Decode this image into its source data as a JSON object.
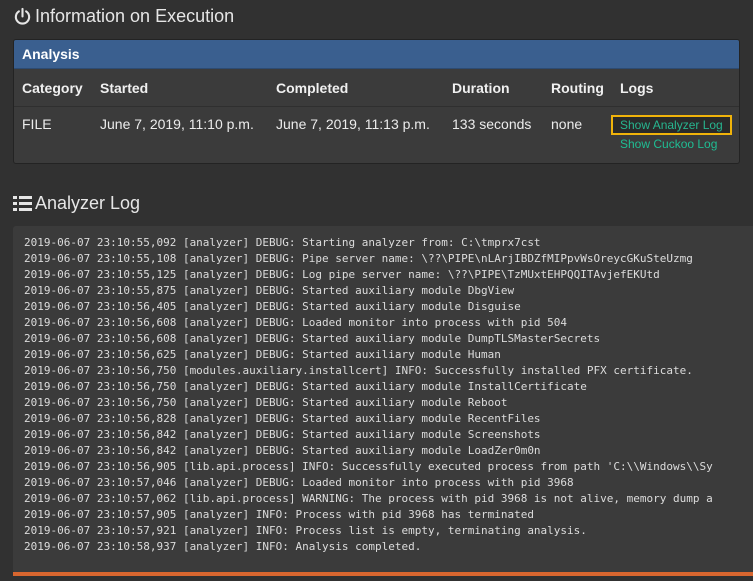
{
  "execution": {
    "title": "Information on Execution",
    "title_icon": "power-icon",
    "panel_title": "Analysis",
    "headers": [
      "Category",
      "Started",
      "Completed",
      "Duration",
      "Routing",
      "Logs"
    ],
    "row": {
      "category": "FILE",
      "started": "June 7, 2019, 11:10 p.m.",
      "completed": "June 7, 2019, 11:13 p.m.",
      "duration": "133 seconds",
      "routing": "none"
    },
    "links": {
      "analyzer": "Show Analyzer Log",
      "cuckoo": "Show Cuckoo Log"
    }
  },
  "analyzer_log": {
    "title": "Analyzer Log",
    "title_icon": "list-icon",
    "lines": [
      "2019-06-07 23:10:55,092 [analyzer] DEBUG: Starting analyzer from: C:\\tmprx7cst",
      "2019-06-07 23:10:55,108 [analyzer] DEBUG: Pipe server name: \\??\\PIPE\\nLArjIBDZfMIPpvWsOreycGKuSteUzmg",
      "2019-06-07 23:10:55,125 [analyzer] DEBUG: Log pipe server name: \\??\\PIPE\\TzMUxtEHPQQITAvjefEKUtd",
      "2019-06-07 23:10:55,875 [analyzer] DEBUG: Started auxiliary module DbgView",
      "2019-06-07 23:10:56,405 [analyzer] DEBUG: Started auxiliary module Disguise",
      "2019-06-07 23:10:56,608 [analyzer] DEBUG: Loaded monitor into process with pid 504",
      "2019-06-07 23:10:56,608 [analyzer] DEBUG: Started auxiliary module DumpTLSMasterSecrets",
      "2019-06-07 23:10:56,625 [analyzer] DEBUG: Started auxiliary module Human",
      "2019-06-07 23:10:56,750 [modules.auxiliary.installcert] INFO: Successfully installed PFX certificate.",
      "2019-06-07 23:10:56,750 [analyzer] DEBUG: Started auxiliary module InstallCertificate",
      "2019-06-07 23:10:56,750 [analyzer] DEBUG: Started auxiliary module Reboot",
      "2019-06-07 23:10:56,828 [analyzer] DEBUG: Started auxiliary module RecentFiles",
      "2019-06-07 23:10:56,842 [analyzer] DEBUG: Started auxiliary module Screenshots",
      "2019-06-07 23:10:56,842 [analyzer] DEBUG: Started auxiliary module LoadZer0m0n",
      "2019-06-07 23:10:56,905 [lib.api.process] INFO: Successfully executed process from path 'C:\\\\Windows\\\\Sy",
      "2019-06-07 23:10:57,046 [analyzer] DEBUG: Loaded monitor into process with pid 3968",
      "2019-06-07 23:10:57,062 [lib.api.process] WARNING: The process with pid 3968 is not alive, memory dump a",
      "2019-06-07 23:10:57,905 [analyzer] INFO: Process with pid 3968 has terminated",
      "2019-06-07 23:10:57,921 [analyzer] INFO: Process list is empty, terminating analysis.",
      "2019-06-07 23:10:58,937 [analyzer] INFO: Analysis completed."
    ]
  },
  "colors": {
    "background": "#313131",
    "panel_header": "#3a5f8f",
    "link": "#1fbd93",
    "highlight_border": "#f0b30a",
    "accent_bar": "#d8662f"
  }
}
